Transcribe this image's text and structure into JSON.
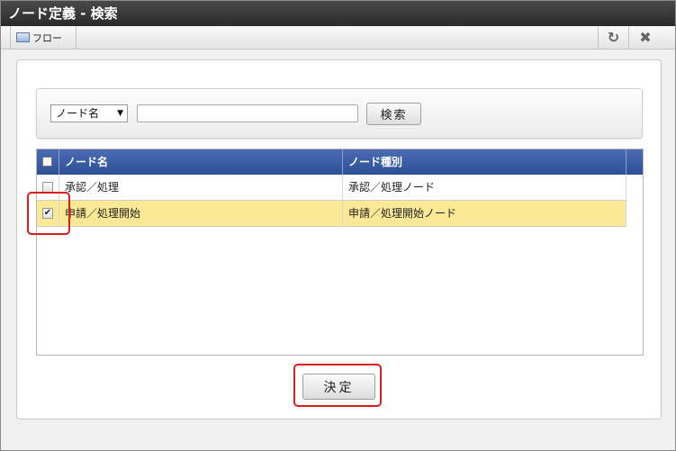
{
  "window": {
    "title": "ノード定義 - 検索"
  },
  "toolbar": {
    "flow_label": "フロー",
    "refresh_icon": "↻",
    "close_icon": "✖"
  },
  "search": {
    "field_select": "ノード名",
    "select_arrow": "▼",
    "input_value": "",
    "input_placeholder": "",
    "button_label": "検索"
  },
  "grid": {
    "columns": [
      "ノード名",
      "ノード種別"
    ],
    "rows": [
      {
        "name": "承認／処理",
        "type": "承認／処理ノード",
        "checked": false,
        "check_glyph": ""
      },
      {
        "name": "申請／処理開始",
        "type": "申請／処理開始ノード",
        "checked": true,
        "check_glyph": "✔"
      }
    ]
  },
  "footer": {
    "decide_label": "決定"
  },
  "colors": {
    "header_blue": "#2c4f96",
    "selected_row": "#fbe996",
    "highlight_red": "#d81e1e"
  }
}
